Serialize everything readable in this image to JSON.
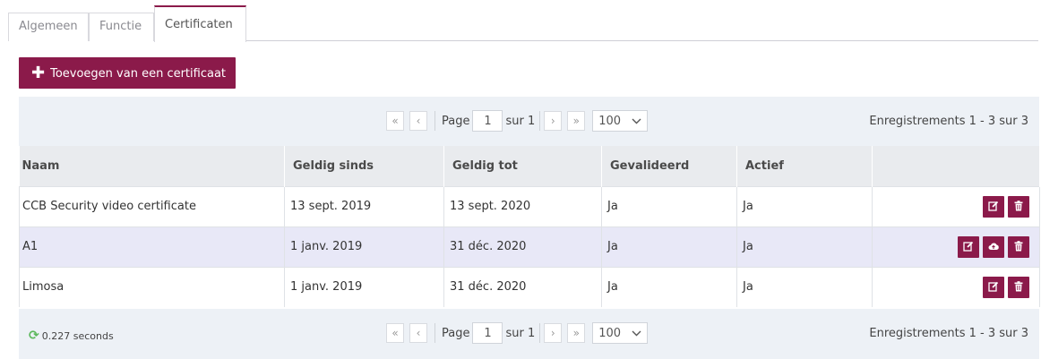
{
  "tabs": [
    {
      "label": "Algemeen"
    },
    {
      "label": "Functie"
    },
    {
      "label": "Certificaten"
    }
  ],
  "add_button": {
    "label": "Toevoegen van een certificaat",
    "icon": "plus-icon"
  },
  "pager": {
    "first": "«",
    "prev": "‹",
    "next": "›",
    "last": "»",
    "page_label": "Page",
    "page_value": "1",
    "of_label": "sur 1",
    "page_size": "100",
    "records": "Enregistrements 1 - 3 sur 3"
  },
  "timing": "0.227 seconds",
  "columns": [
    "Naam",
    "Geldig sinds",
    "Geldig tot",
    "Gevalideerd",
    "Actief",
    ""
  ],
  "rows": [
    {
      "naam": "CCB Security video certificate",
      "sinds": "13 sept. 2019",
      "tot": "13 sept. 2020",
      "gevalideerd": "Ja",
      "actief": "Ja",
      "actions": [
        "edit",
        "delete"
      ]
    },
    {
      "naam": "A1",
      "sinds": "1 janv. 2019",
      "tot": "31 déc. 2020",
      "gevalideerd": "Ja",
      "actief": "Ja",
      "actions": [
        "edit",
        "upload",
        "delete"
      ]
    },
    {
      "naam": "Limosa",
      "sinds": "1 janv. 2019",
      "tot": "31 déc. 2020",
      "gevalideerd": "Ja",
      "actief": "Ja",
      "actions": [
        "edit",
        "delete"
      ]
    }
  ],
  "colors": {
    "accent": "#8b1a4a",
    "header_bg": "#e9ebee",
    "pager_bg": "#edf1f6",
    "highlight": "#e8e8f7"
  }
}
